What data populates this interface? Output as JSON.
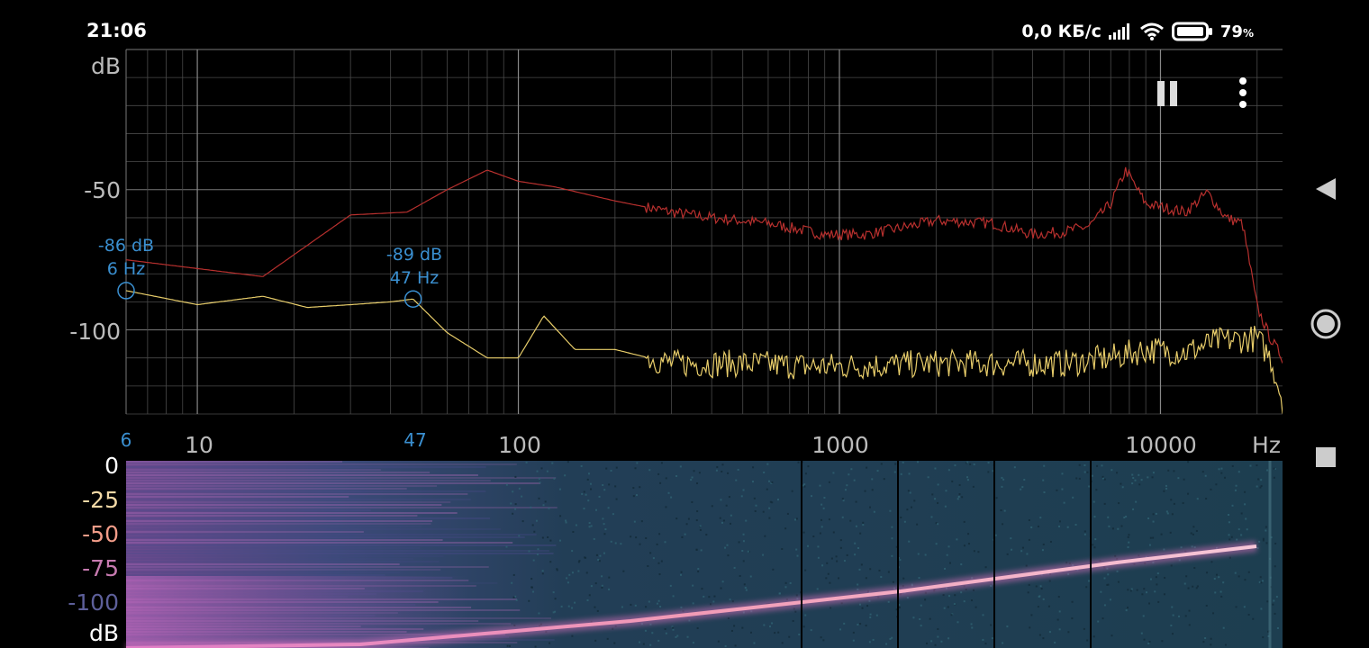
{
  "status_bar": {
    "time": "21:06",
    "network_speed": "0,0 КБ/с",
    "battery_percent": "79",
    "battery_unit": "%",
    "icons": [
      "signal-icon",
      "wifi-icon",
      "battery-icon"
    ]
  },
  "spectrum": {
    "y_unit": "dB",
    "x_unit": "Hz",
    "y_ticks": [
      "-50",
      "-100"
    ],
    "x_ticks": [
      "10",
      "100",
      "1000",
      "10000"
    ],
    "cursor_a": {
      "db_label": "-86 dB",
      "hz_label": "6 Hz",
      "axis_label": "6",
      "freq": 6,
      "db": -86
    },
    "cursor_b": {
      "db_label": "-89 dB",
      "hz_label": "47 Hz",
      "axis_label": "47",
      "freq": 47,
      "db": -89
    },
    "colors": {
      "peak": "#b8302e",
      "live": "#e8cd6a",
      "cursor": "#3a8fd0",
      "grid": "#4a4a4a"
    }
  },
  "chart_data": {
    "type": "line",
    "xlabel": "Hz",
    "ylabel": "dB",
    "x_scale": "log",
    "xlim": [
      6,
      24000
    ],
    "ylim": [
      -130,
      0
    ],
    "series": [
      {
        "x": [
          6,
          16,
          30,
          45,
          60,
          80,
          100,
          130,
          200,
          300,
          400,
          600,
          900,
          1200,
          1500,
          2000,
          3000,
          4000,
          5000,
          6000,
          7000,
          7800,
          9000,
          12000,
          14000,
          16000,
          18000,
          19000,
          20000,
          22000,
          24000
        ],
        "y": [
          -75,
          -81,
          -59,
          -58,
          -50,
          -43,
          -47,
          -49,
          -54,
          -58,
          -60,
          -62,
          -66,
          -66,
          -64,
          -61,
          -62,
          -66,
          -65,
          -63,
          -55,
          -43,
          -55,
          -58,
          -51,
          -60,
          -62,
          -77,
          -92,
          -103,
          -110
        ]
      },
      {
        "x": [
          6,
          10,
          16,
          22,
          30,
          40,
          47,
          60,
          80,
          100,
          120,
          150,
          200,
          300,
          500,
          800,
          1000,
          2000,
          3000,
          5000,
          7000,
          9000,
          12000,
          15000,
          20000,
          22000,
          24000
        ],
        "y": [
          -86,
          -91,
          -88,
          -92,
          -91,
          -90,
          -89,
          -101,
          -110,
          -110,
          -95,
          -107,
          -107,
          -112,
          -112,
          -113,
          -113,
          -112,
          -112,
          -112,
          -110,
          -107,
          -108,
          -104,
          -103,
          -110,
          -125
        ]
      }
    ]
  },
  "spectrogram": {
    "db_ticks": [
      "0",
      "-25",
      "-50",
      "-75",
      "-100",
      "dB"
    ],
    "db_colors": [
      "#ffffff",
      "#f3d9a6",
      "#f29c88",
      "#c77ab0",
      "#5d5f9a",
      "#ffffff"
    ]
  },
  "controls": {
    "pause_icon": "pause-icon",
    "menu_icon": "more-vert-icon"
  },
  "nav": [
    "back-icon",
    "home-icon",
    "recents-icon"
  ]
}
